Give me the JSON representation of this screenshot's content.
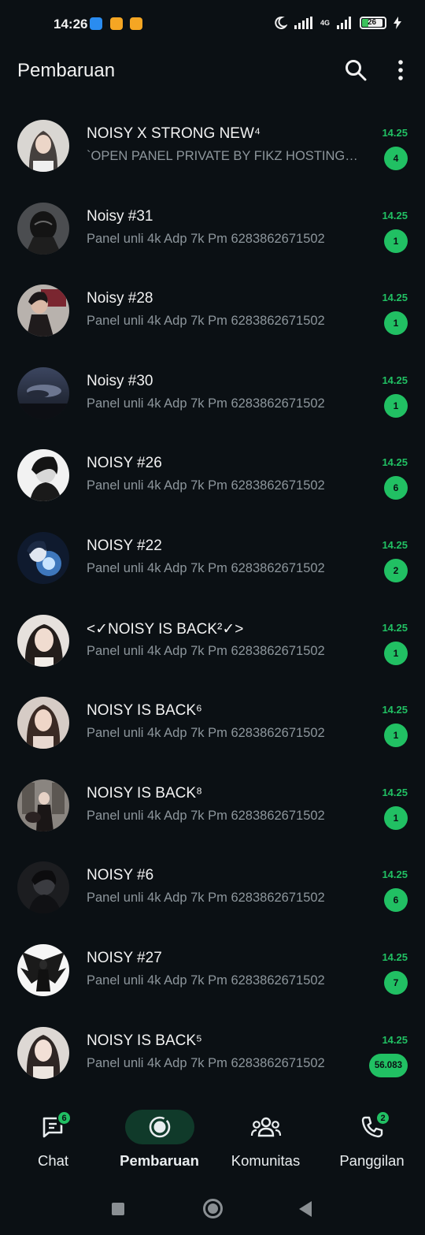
{
  "status_bar": {
    "time": "14:26",
    "network": "4G",
    "battery": "26"
  },
  "header": {
    "title": "Pembaruan",
    "icons": [
      "search-icon",
      "more-vert-icon"
    ]
  },
  "colors": {
    "accent": "#21c063",
    "background": "#0b1014",
    "nav_active": "#103a2a",
    "secondary_text": "#8d969c"
  },
  "chats": [
    {
      "name": "NOISY X STRONG NEW⁴",
      "message": "`OPEN PANEL PRIVATE BY FIKZ HOSTING`🐣...",
      "time": "14.25",
      "unread": "4"
    },
    {
      "name": "Noisy #31",
      "message": "Panel unli 4k  Adp 7k Pm 6283862671502",
      "time": "14.25",
      "unread": "1"
    },
    {
      "name": "Noisy #28",
      "message": "Panel unli 4k  Adp 7k Pm 6283862671502",
      "time": "14.25",
      "unread": "1"
    },
    {
      "name": "Noisy #30",
      "message": "Panel unli 4k  Adp 7k Pm 6283862671502",
      "time": "14.25",
      "unread": "1"
    },
    {
      "name": "NOISY #26",
      "message": "Panel unli 4k  Adp 7k Pm 6283862671502",
      "time": "14.25",
      "unread": "6"
    },
    {
      "name": "NOISY #22",
      "message": "Panel unli 4k  Adp 7k Pm 6283862671502",
      "time": "14.25",
      "unread": "2"
    },
    {
      "name": "<✓NOISY IS BACK²✓>",
      "message": "Panel unli 4k  Adp 7k Pm 6283862671502",
      "time": "14.25",
      "unread": "1"
    },
    {
      "name": "NOISY IS BACK⁶",
      "message": "Panel unli 4k  Adp 7k Pm 6283862671502",
      "time": "14.25",
      "unread": "1"
    },
    {
      "name": "NOISY IS BACK⁸",
      "message": "Panel unli 4k  Adp 7k Pm 6283862671502",
      "time": "14.25",
      "unread": "1"
    },
    {
      "name": "NOISY #6",
      "message": "Panel unli 4k  Adp 7k Pm 6283862671502",
      "time": "14.25",
      "unread": "6"
    },
    {
      "name": "NOISY #27",
      "message": "Panel unli 4k  Adp 7k Pm 6283862671502",
      "time": "14.25",
      "unread": "7"
    },
    {
      "name": "NOISY IS BACK⁵",
      "message": "Panel unli 4k  Adp 7k Pm 6283862671502",
      "time": "14.25",
      "unread": "56.083"
    }
  ],
  "bottom_nav": [
    {
      "label": "Chat",
      "icon": "chat-icon",
      "badge": "6",
      "active": false
    },
    {
      "label": "Pembaruan",
      "icon": "updates-icon",
      "badge": "",
      "active": true
    },
    {
      "label": "Komunitas",
      "icon": "communities-icon",
      "badge": "",
      "active": false
    },
    {
      "label": "Panggilan",
      "icon": "phone-icon",
      "badge": "2",
      "active": false
    }
  ]
}
